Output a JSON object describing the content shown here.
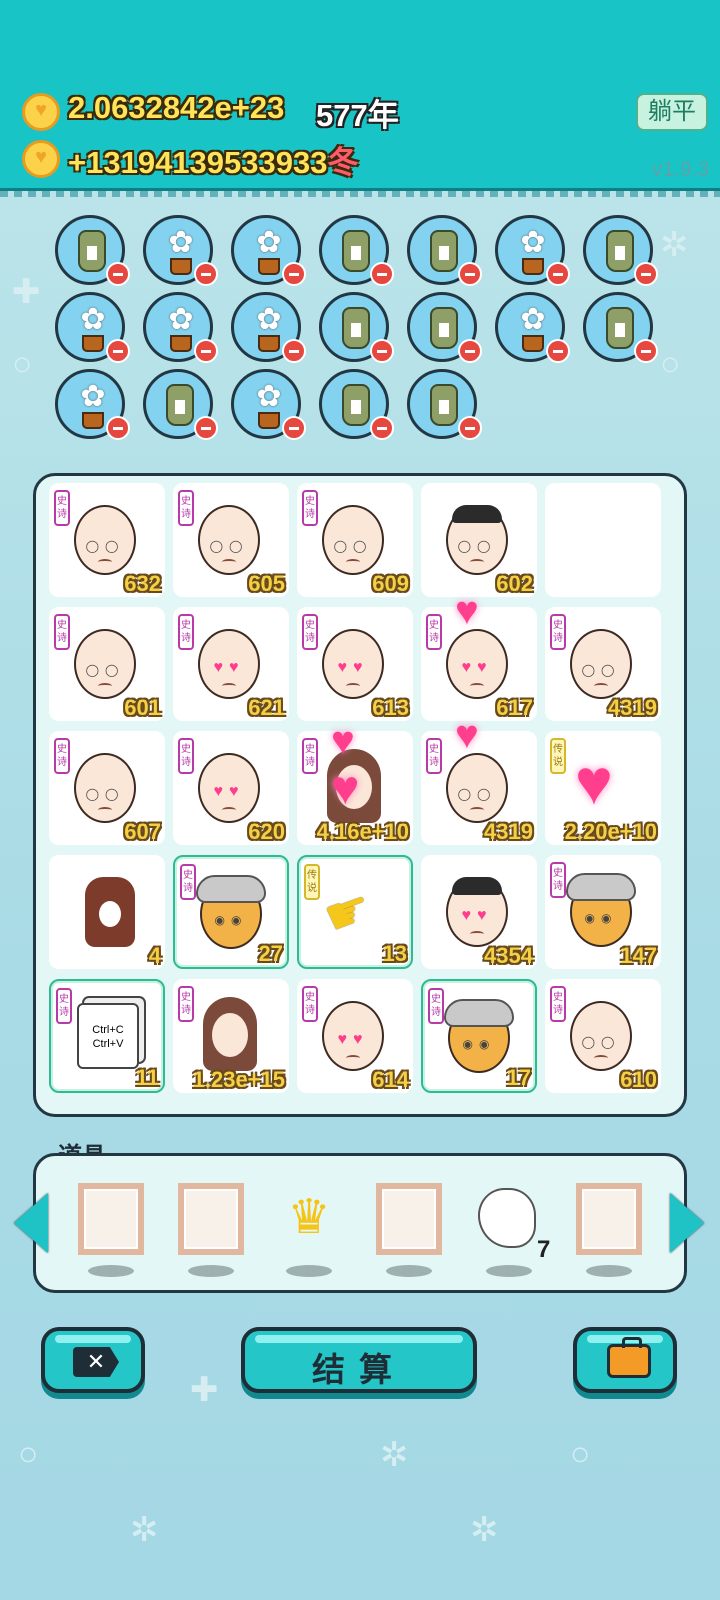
{
  "header": {
    "money": "2.0632842e+23",
    "years": "577年",
    "income": "+13194139533933",
    "season": "冬",
    "tangping_label": "躺平",
    "version": "v1.9.3"
  },
  "items": [
    [
      "bag",
      "flower",
      "flower",
      "bag",
      "bag",
      "flower",
      "bag"
    ],
    [
      "flower",
      "flower",
      "flower",
      "bag",
      "bag",
      "flower",
      "bag"
    ],
    [
      "flower",
      "bag",
      "flower",
      "bag",
      "bag"
    ]
  ],
  "rarity": {
    "epic": "史诗",
    "legend": "传说"
  },
  "board": [
    [
      {
        "type": "old",
        "badge": "epic",
        "value": "632"
      },
      {
        "type": "old",
        "badge": "epic",
        "value": "605"
      },
      {
        "type": "old",
        "badge": "epic",
        "value": "609"
      },
      {
        "type": "man",
        "badge": "",
        "value": "602"
      },
      {
        "type": "empty",
        "badge": "",
        "value": ""
      }
    ],
    [
      {
        "type": "old",
        "badge": "epic",
        "value": "601"
      },
      {
        "type": "old-pink",
        "badge": "epic",
        "value": "621"
      },
      {
        "type": "old-pink",
        "badge": "epic",
        "value": "613"
      },
      {
        "type": "old-pink-heart",
        "badge": "epic",
        "value": "617"
      },
      {
        "type": "old",
        "badge": "epic",
        "value": "4319"
      }
    ],
    [
      {
        "type": "old",
        "badge": "epic",
        "value": "607"
      },
      {
        "type": "old-pink",
        "badge": "epic",
        "value": "620"
      },
      {
        "type": "girl-heart",
        "badge": "epic",
        "value": "4.16e+10"
      },
      {
        "type": "old-heart",
        "badge": "epic",
        "value": "4319"
      },
      {
        "type": "heart",
        "badge": "legend",
        "value": "2.20e+10"
      }
    ],
    [
      {
        "type": "dog",
        "badge": "",
        "value": "4"
      },
      {
        "type": "chick",
        "badge": "epic",
        "value": "27",
        "hl": true
      },
      {
        "type": "hand",
        "badge": "legend",
        "value": "13",
        "hl": true
      },
      {
        "type": "man-pink",
        "badge": "",
        "value": "4354"
      },
      {
        "type": "chick",
        "badge": "epic",
        "value": "147"
      }
    ],
    [
      {
        "type": "cards",
        "badge": "epic",
        "value": "11",
        "hl": true
      },
      {
        "type": "girl",
        "badge": "epic",
        "value": "1.23e+15"
      },
      {
        "type": "old-pink",
        "badge": "epic",
        "value": "614"
      },
      {
        "type": "chick",
        "badge": "epic",
        "value": "17",
        "hl": true
      },
      {
        "type": "old",
        "badge": "epic",
        "value": "610"
      }
    ]
  ],
  "cards_text": [
    "Ctrl+C",
    "Ctrl+V"
  ],
  "props": {
    "label": "道具",
    "slots": [
      "frame",
      "frame",
      "crown",
      "frame",
      "bird",
      "frame"
    ],
    "bird_count": "7"
  },
  "buttons": {
    "settle_label": "结算"
  },
  "colors": {
    "primary": "#18c4c6",
    "dark": "#233743",
    "accent_yellow": "#f4d044",
    "pink": "#ff3f8d"
  },
  "icons": {
    "close": "close-icon",
    "bag": "briefcase-icon",
    "left": "arrow-left-icon",
    "right": "arrow-right-icon"
  }
}
